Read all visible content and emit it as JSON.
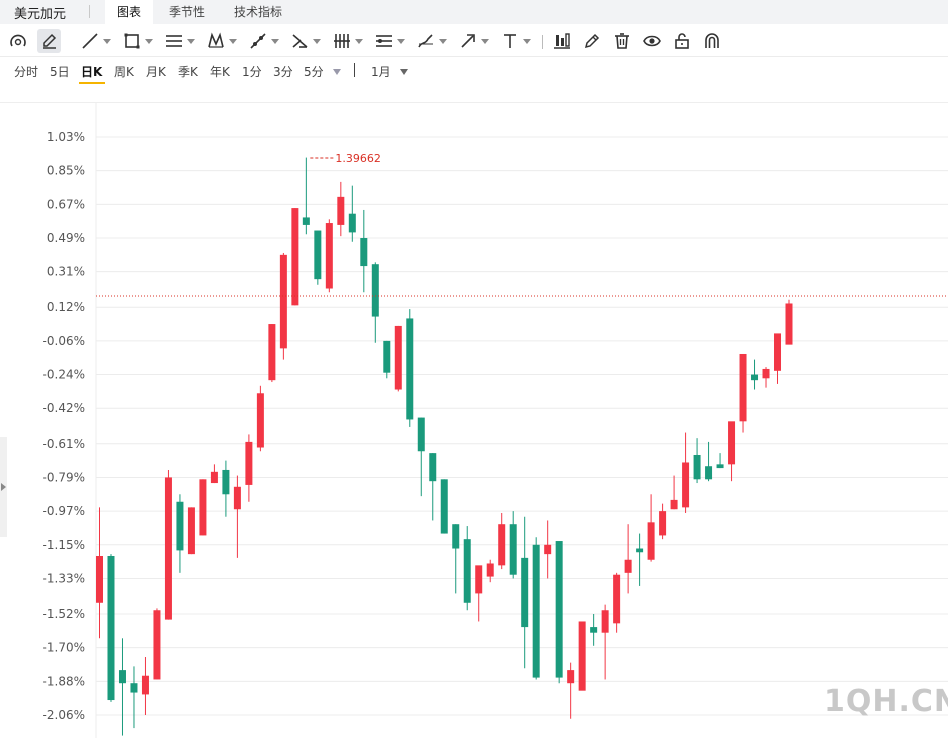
{
  "header": {
    "symbol": "美元加元",
    "tabs": [
      {
        "label": "图表",
        "active": true
      },
      {
        "label": "季节性",
        "active": false
      },
      {
        "label": "技术指标",
        "active": false
      }
    ]
  },
  "toolbar": {
    "tools": [
      {
        "icon": "magnet-cursor-icon",
        "dropdown": false
      },
      {
        "icon": "pencil-edit-icon",
        "dropdown": false,
        "selected": true
      },
      {
        "icon": "line-tool-icon",
        "dropdown": true
      },
      {
        "icon": "rectangle-tool-icon",
        "dropdown": true
      },
      {
        "icon": "horizontal-lines-tool-icon",
        "dropdown": true
      },
      {
        "icon": "pattern-tool-icon",
        "dropdown": true
      },
      {
        "icon": "ray-tool-icon",
        "dropdown": true
      },
      {
        "icon": "fibonacci-tool-icon",
        "dropdown": true
      },
      {
        "icon": "gann-tool-icon",
        "dropdown": true
      },
      {
        "icon": "parallel-channel-tool-icon",
        "dropdown": true
      },
      {
        "icon": "brush-tool-icon",
        "dropdown": true
      },
      {
        "icon": "arrow-tool-icon",
        "dropdown": true
      },
      {
        "icon": "text-tool-icon",
        "dropdown": true
      },
      {
        "icon": "measure-tool-icon",
        "dropdown": false
      },
      {
        "icon": "pen-icon",
        "dropdown": false
      },
      {
        "icon": "trash-icon",
        "dropdown": false
      },
      {
        "icon": "eye-icon",
        "dropdown": false
      },
      {
        "icon": "lock-icon",
        "dropdown": false
      },
      {
        "icon": "magnet-icon",
        "dropdown": false
      }
    ]
  },
  "periods": {
    "items": [
      {
        "label": "分时",
        "active": false
      },
      {
        "label": "5日",
        "active": false
      },
      {
        "label": "日K",
        "active": true
      },
      {
        "label": "周K",
        "active": false
      },
      {
        "label": "月K",
        "active": false
      },
      {
        "label": "季K",
        "active": false
      },
      {
        "label": "年K",
        "active": false
      },
      {
        "label": "1分",
        "active": false
      },
      {
        "label": "3分",
        "active": false
      },
      {
        "label": "5分",
        "active": false
      }
    ],
    "range_label": "1月"
  },
  "chart_data": {
    "type": "candlestick",
    "yaxis": {
      "unit": "%",
      "ticks": [
        "1.03%",
        "0.85%",
        "0.67%",
        "0.49%",
        "0.31%",
        "0.12%",
        "-0.06%",
        "-0.24%",
        "-0.42%",
        "-0.61%",
        "-0.79%",
        "-0.97%",
        "-1.15%",
        "-1.33%",
        "-1.52%",
        "-1.70%",
        "-1.88%",
        "-2.06%"
      ],
      "tick_values": [
        1.03,
        0.85,
        0.67,
        0.49,
        0.31,
        0.12,
        -0.06,
        -0.24,
        -0.42,
        -0.61,
        -0.79,
        -0.97,
        -1.15,
        -1.33,
        -1.52,
        -1.7,
        -1.88,
        -2.06
      ],
      "range": [
        -2.06,
        1.03
      ]
    },
    "max_label": "1.39662",
    "max_value_pct": 0.918,
    "current_price_pct": 0.18,
    "colors": {
      "up": "#f23645",
      "down": "#1a9a7c",
      "grid": "#ececec",
      "axis_text": "#555555",
      "annotation": "#d93025",
      "price_line": "#d93025"
    },
    "candles": [
      {
        "o": -1.46,
        "c": -1.21,
        "h": -0.95,
        "l": -1.65
      },
      {
        "o": -1.21,
        "c": -1.98,
        "h": -1.2,
        "l": -1.99
      },
      {
        "o": -1.82,
        "c": -1.89,
        "h": -1.65,
        "l": -2.17
      },
      {
        "o": -1.89,
        "c": -1.94,
        "h": -1.8,
        "l": -2.13
      },
      {
        "o": -1.95,
        "c": -1.85,
        "h": -1.75,
        "l": -2.06
      },
      {
        "o": -1.87,
        "c": -1.5,
        "h": -1.49,
        "l": -1.87
      },
      {
        "o": -1.55,
        "c": -0.79,
        "h": -0.75,
        "l": -1.55
      },
      {
        "o": -0.92,
        "c": -1.18,
        "h": -0.88,
        "l": -1.3
      },
      {
        "o": -1.2,
        "c": -0.95,
        "h": -0.95,
        "l": -1.2
      },
      {
        "o": -1.1,
        "c": -0.8,
        "h": -0.8,
        "l": -1.1
      },
      {
        "o": -0.82,
        "c": -0.76,
        "h": -0.72,
        "l": -0.82
      },
      {
        "o": -0.75,
        "c": -0.88,
        "h": -0.7,
        "l": -1.0
      },
      {
        "o": -0.96,
        "c": -0.84,
        "h": -0.78,
        "l": -1.22
      },
      {
        "o": -0.83,
        "c": -0.6,
        "h": -0.56,
        "l": -0.92
      },
      {
        "o": -0.63,
        "c": -0.34,
        "h": -0.3,
        "l": -0.65
      },
      {
        "o": -0.27,
        "c": 0.03,
        "h": 0.03,
        "l": -0.28
      },
      {
        "o": -0.1,
        "c": 0.4,
        "h": 0.41,
        "l": -0.16
      },
      {
        "o": 0.13,
        "c": 0.65,
        "h": 0.65,
        "l": 0.13
      },
      {
        "o": 0.6,
        "c": 0.56,
        "h": 0.92,
        "l": 0.51
      },
      {
        "o": 0.53,
        "c": 0.27,
        "h": 0.53,
        "l": 0.24
      },
      {
        "o": 0.22,
        "c": 0.57,
        "h": 0.59,
        "l": 0.2
      },
      {
        "o": 0.56,
        "c": 0.71,
        "h": 0.79,
        "l": 0.5
      },
      {
        "o": 0.62,
        "c": 0.52,
        "h": 0.77,
        "l": 0.47
      },
      {
        "o": 0.49,
        "c": 0.34,
        "h": 0.64,
        "l": 0.2
      },
      {
        "o": 0.35,
        "c": 0.07,
        "h": 0.36,
        "l": -0.07
      },
      {
        "o": -0.06,
        "c": -0.23,
        "h": -0.06,
        "l": -0.26
      },
      {
        "o": -0.32,
        "c": 0.02,
        "h": 0.02,
        "l": -0.33
      },
      {
        "o": 0.06,
        "c": -0.48,
        "h": 0.11,
        "l": -0.52
      },
      {
        "o": -0.47,
        "c": -0.65,
        "h": -0.47,
        "l": -0.89
      },
      {
        "o": -0.66,
        "c": -0.81,
        "h": -0.66,
        "l": -1.02
      },
      {
        "o": -0.8,
        "c": -1.09,
        "h": -0.8,
        "l": -1.09
      },
      {
        "o": -1.04,
        "c": -1.17,
        "h": -1.04,
        "l": -1.41
      },
      {
        "o": -1.12,
        "c": -1.46,
        "h": -1.05,
        "l": -1.5
      },
      {
        "o": -1.41,
        "c": -1.26,
        "h": -1.27,
        "l": -1.56
      },
      {
        "o": -1.32,
        "c": -1.25,
        "h": -1.23,
        "l": -1.35
      },
      {
        "o": -1.26,
        "c": -1.04,
        "h": -0.98,
        "l": -1.28
      },
      {
        "o": -1.04,
        "c": -1.31,
        "h": -0.97,
        "l": -1.33
      },
      {
        "o": -1.22,
        "c": -1.59,
        "h": -1.0,
        "l": -1.81
      },
      {
        "o": -1.15,
        "c": -1.86,
        "h": -1.11,
        "l": -1.87
      },
      {
        "o": -1.2,
        "c": -1.15,
        "h": -1.02,
        "l": -1.33
      },
      {
        "o": -1.13,
        "c": -1.86,
        "h": -1.14,
        "l": -1.89
      },
      {
        "o": -1.89,
        "c": -1.82,
        "h": -1.78,
        "l": -2.08
      },
      {
        "o": -1.93,
        "c": -1.56,
        "h": -1.93,
        "l": -1.93
      },
      {
        "o": -1.59,
        "c": -1.62,
        "h": -1.52,
        "l": -1.69
      },
      {
        "o": -1.62,
        "c": -1.5,
        "h": -1.47,
        "l": -1.87
      },
      {
        "o": -1.57,
        "c": -1.31,
        "h": -1.3,
        "l": -1.62
      },
      {
        "o": -1.3,
        "c": -1.23,
        "h": -1.04,
        "l": -1.41
      },
      {
        "o": -1.17,
        "c": -1.19,
        "h": -1.09,
        "l": -1.37
      },
      {
        "o": -1.23,
        "c": -1.03,
        "h": -0.88,
        "l": -1.24
      },
      {
        "o": -1.1,
        "c": -0.97,
        "h": -0.93,
        "l": -1.12
      },
      {
        "o": -0.96,
        "c": -0.91,
        "h": -0.78,
        "l": -0.96
      },
      {
        "o": -0.95,
        "c": -0.71,
        "h": -0.55,
        "l": -0.98
      },
      {
        "o": -0.67,
        "c": -0.8,
        "h": -0.58,
        "l": -0.82
      },
      {
        "o": -0.73,
        "c": -0.8,
        "h": -0.6,
        "l": -0.81
      },
      {
        "o": -0.72,
        "c": -0.74,
        "h": -0.66,
        "l": -0.74
      },
      {
        "o": -0.72,
        "c": -0.49,
        "h": -0.5,
        "l": -0.81
      },
      {
        "o": -0.49,
        "c": -0.13,
        "h": -0.13,
        "l": -0.55
      },
      {
        "o": -0.24,
        "c": -0.27,
        "h": -0.16,
        "l": -0.32
      },
      {
        "o": -0.26,
        "c": -0.21,
        "h": -0.2,
        "l": -0.31
      },
      {
        "o": -0.22,
        "c": -0.02,
        "h": -0.08,
        "l": -0.29
      },
      {
        "o": -0.08,
        "c": 0.14,
        "h": 0.16,
        "l": -0.07
      }
    ]
  }
}
